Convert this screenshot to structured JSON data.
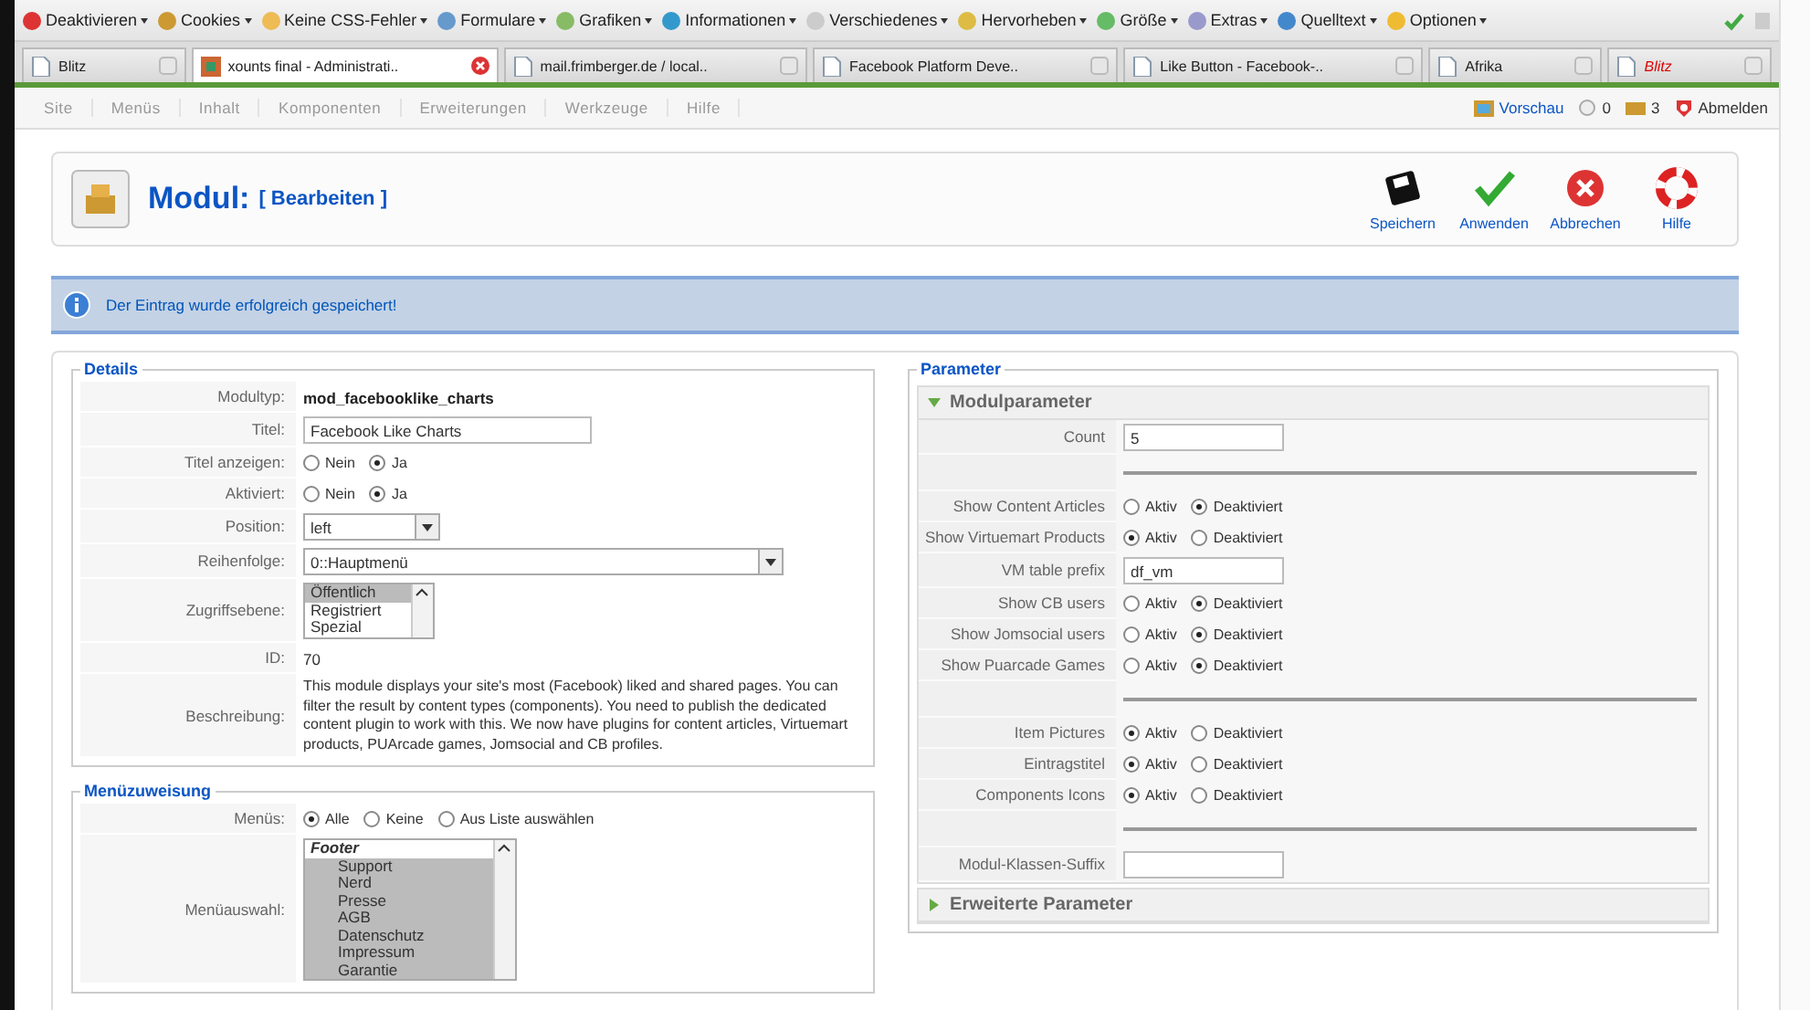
{
  "dev_toolbar": {
    "items": [
      {
        "label": "Deaktivieren"
      },
      {
        "label": "Cookies"
      },
      {
        "label": "Keine CSS-Fehler"
      },
      {
        "label": "Formulare"
      },
      {
        "label": "Grafiken"
      },
      {
        "label": "Informationen"
      },
      {
        "label": "Verschiedenes"
      },
      {
        "label": "Hervorheben"
      },
      {
        "label": "Größe"
      },
      {
        "label": "Extras"
      },
      {
        "label": "Quelltext"
      },
      {
        "label": "Optionen"
      }
    ]
  },
  "tabs": [
    {
      "label": "Blitz",
      "selected": false,
      "emphasized": false
    },
    {
      "label": "xounts final - Administrati..",
      "selected": true,
      "emphasized": false
    },
    {
      "label": "mail.frimberger.de / local..",
      "selected": false,
      "emphasized": false
    },
    {
      "label": "Facebook Platform Deve..",
      "selected": false,
      "emphasized": false
    },
    {
      "label": "Like Button - Facebook-..",
      "selected": false,
      "emphasized": false
    },
    {
      "label": "Afrika",
      "selected": false,
      "emphasized": false
    },
    {
      "label": "Blitz",
      "selected": false,
      "emphasized": true
    }
  ],
  "admin_menu": {
    "items": [
      "Site",
      "Menüs",
      "Inhalt",
      "Komponenten",
      "Erweiterungen",
      "Werkzeuge",
      "Hilfe"
    ],
    "preview": "Vorschau",
    "messages": "0",
    "users": "3",
    "logout": "Abmelden"
  },
  "header": {
    "title": "Modul:",
    "subtitle": "[ Bearbeiten ]",
    "actions": [
      {
        "kind": "save",
        "label": "Speichern"
      },
      {
        "kind": "apply",
        "label": "Anwenden"
      },
      {
        "kind": "cancel",
        "label": "Abbrechen"
      },
      {
        "kind": "help",
        "label": "Hilfe"
      }
    ]
  },
  "message": "Der Eintrag wurde erfolgreich gespeichert!",
  "details": {
    "legend": "Details",
    "rows": [
      {
        "kind": "static",
        "label": "Modultyp:",
        "value": "mod_facebooklike_charts",
        "bold": true
      },
      {
        "kind": "text",
        "label": "Titel:",
        "value": "Facebook Like Charts"
      },
      {
        "kind": "radio",
        "label": "Titel anzeigen:",
        "options": [
          {
            "label": "Nein",
            "selected": false
          },
          {
            "label": "Ja",
            "selected": true
          }
        ]
      },
      {
        "kind": "radio",
        "label": "Aktiviert:",
        "options": [
          {
            "label": "Nein",
            "selected": false
          },
          {
            "label": "Ja",
            "selected": true
          }
        ]
      },
      {
        "kind": "select",
        "label": "Position:",
        "value": "left"
      },
      {
        "kind": "wide_select",
        "label": "Reihenfolge:",
        "value": "0::Hauptmenü"
      },
      {
        "kind": "listbox",
        "label": "Zugriffsebene:",
        "options": [
          {
            "label": "Öffentlich",
            "selected": true
          },
          {
            "label": "Registriert",
            "selected": false
          },
          {
            "label": "Spezial",
            "selected": false
          }
        ]
      },
      {
        "kind": "static",
        "label": "ID:",
        "value": "70",
        "bold": false
      },
      {
        "kind": "description",
        "label": "Beschreibung:",
        "value": "This module displays your site's most (Facebook) liked and shared pages. You can filter the result by content types (components). You need to publish the dedicated content plugin to work with this. We now have plugins for content articles, Virtuemart products, PUArcade games, Jomsocial and CB profiles."
      }
    ]
  },
  "menu_assignment": {
    "legend": "Menüzuweisung",
    "rows": [
      {
        "kind": "radio",
        "label": "Menüs:",
        "options": [
          {
            "label": "Alle",
            "selected": true
          },
          {
            "label": "Keine",
            "selected": false
          },
          {
            "label": "Aus Liste auswählen",
            "selected": false
          }
        ]
      },
      {
        "kind": "menulist",
        "label": "Menüauswahl:",
        "options": [
          {
            "label": "Footer",
            "kind": "group",
            "selected": false
          },
          {
            "label": "Support",
            "kind": "item",
            "selected": true
          },
          {
            "label": "Nerd",
            "kind": "item",
            "selected": true
          },
          {
            "label": "Presse",
            "kind": "item",
            "selected": true
          },
          {
            "label": "AGB",
            "kind": "item",
            "selected": true
          },
          {
            "label": "Datenschutz",
            "kind": "item",
            "selected": true
          },
          {
            "label": "Impressum",
            "kind": "item",
            "selected": true
          },
          {
            "label": "Garantie",
            "kind": "item",
            "selected": true
          }
        ]
      }
    ]
  },
  "parameters": {
    "legend": "Parameter",
    "panels": [
      {
        "title": "Modulparameter",
        "expanded": true,
        "rows": [
          {
            "kind": "text",
            "label": "Count",
            "value": "5"
          },
          {
            "kind": "separator"
          },
          {
            "kind": "radio",
            "label": "Show Content Articles",
            "options": [
              {
                "label": "Aktiv",
                "selected": false
              },
              {
                "label": "Deaktiviert",
                "selected": true
              }
            ]
          },
          {
            "kind": "radio",
            "label": "Show Virtuemart Products",
            "options": [
              {
                "label": "Aktiv",
                "selected": true
              },
              {
                "label": "Deaktiviert",
                "selected": false
              }
            ]
          },
          {
            "kind": "text",
            "label": "VM table prefix",
            "value": "df_vm"
          },
          {
            "kind": "radio",
            "label": "Show CB users",
            "options": [
              {
                "label": "Aktiv",
                "selected": false
              },
              {
                "label": "Deaktiviert",
                "selected": true
              }
            ]
          },
          {
            "kind": "radio",
            "label": "Show Jomsocial users",
            "options": [
              {
                "label": "Aktiv",
                "selected": false
              },
              {
                "label": "Deaktiviert",
                "selected": true
              }
            ]
          },
          {
            "kind": "radio",
            "label": "Show Puarcade Games",
            "options": [
              {
                "label": "Aktiv",
                "selected": false
              },
              {
                "label": "Deaktiviert",
                "selected": true
              }
            ]
          },
          {
            "kind": "separator"
          },
          {
            "kind": "radio",
            "label": "Item Pictures",
            "options": [
              {
                "label": "Aktiv",
                "selected": true
              },
              {
                "label": "Deaktiviert",
                "selected": false
              }
            ]
          },
          {
            "kind": "radio",
            "label": "Eintragstitel",
            "options": [
              {
                "label": "Aktiv",
                "selected": true
              },
              {
                "label": "Deaktiviert",
                "selected": false
              }
            ]
          },
          {
            "kind": "radio",
            "label": "Components Icons",
            "options": [
              {
                "label": "Aktiv",
                "selected": true
              },
              {
                "label": "Deaktiviert",
                "selected": false
              }
            ]
          },
          {
            "kind": "separator"
          },
          {
            "kind": "text",
            "label": "Modul-Klassen-Suffix",
            "value": ""
          }
        ]
      },
      {
        "title": "Erweiterte Parameter",
        "expanded": false
      }
    ]
  }
}
